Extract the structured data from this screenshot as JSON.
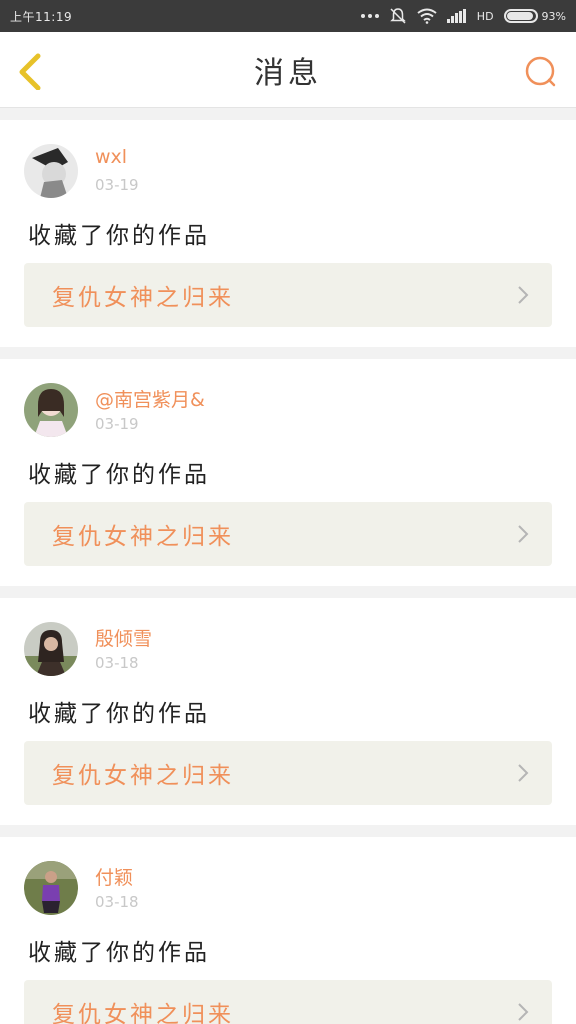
{
  "status": {
    "time": "上午11:19",
    "network": "HD",
    "battery": "93%",
    "battery_level": 0.93
  },
  "header": {
    "title": "消息",
    "back_icon": "chevron-left-icon",
    "search_icon": "search-icon"
  },
  "colors": {
    "accent": "#f0905a",
    "back_icon": "#e7c229"
  },
  "messages": [
    {
      "username": "wxl",
      "date": "03-19",
      "action": "收藏了你的作品",
      "work_title": "复仇女神之归来"
    },
    {
      "username": "@南宫紫月&",
      "date": "03-19",
      "action": "收藏了你的作品",
      "work_title": "复仇女神之归来"
    },
    {
      "username": "殷倾雪",
      "date": "03-18",
      "action": "收藏了你的作品",
      "work_title": "复仇女神之归来"
    },
    {
      "username": "付颖",
      "date": "03-18",
      "action": "收藏了你的作品",
      "work_title": "复仇女神之归来"
    }
  ]
}
